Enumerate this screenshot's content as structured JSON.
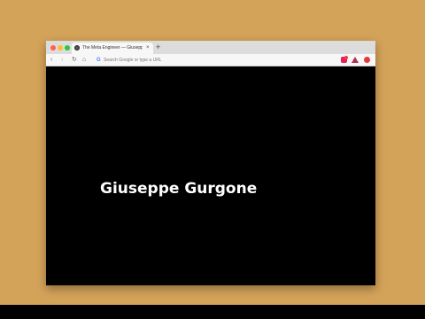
{
  "browser": {
    "tab": {
      "title": "The Meta Engineer — Giuseppe",
      "close_glyph": "×",
      "favicon": "globe-icon"
    },
    "new_tab_glyph": "+",
    "nav": {
      "back_glyph": "‹",
      "forward_glyph": "›",
      "reload_glyph": "↻",
      "home_glyph": "⌂"
    },
    "omnibox": {
      "provider_letter": "G",
      "placeholder": "Search Google or type a URL",
      "value": ""
    },
    "extensions": [
      "heart-extension-icon",
      "triangle-extension-icon",
      "red-circle-extension-icon"
    ]
  },
  "page": {
    "heading": "Giuseppe Gurgone"
  },
  "colors": {
    "backdrop": "#d4a35a",
    "page_background": "#000000",
    "heading_text": "#ffffff"
  }
}
